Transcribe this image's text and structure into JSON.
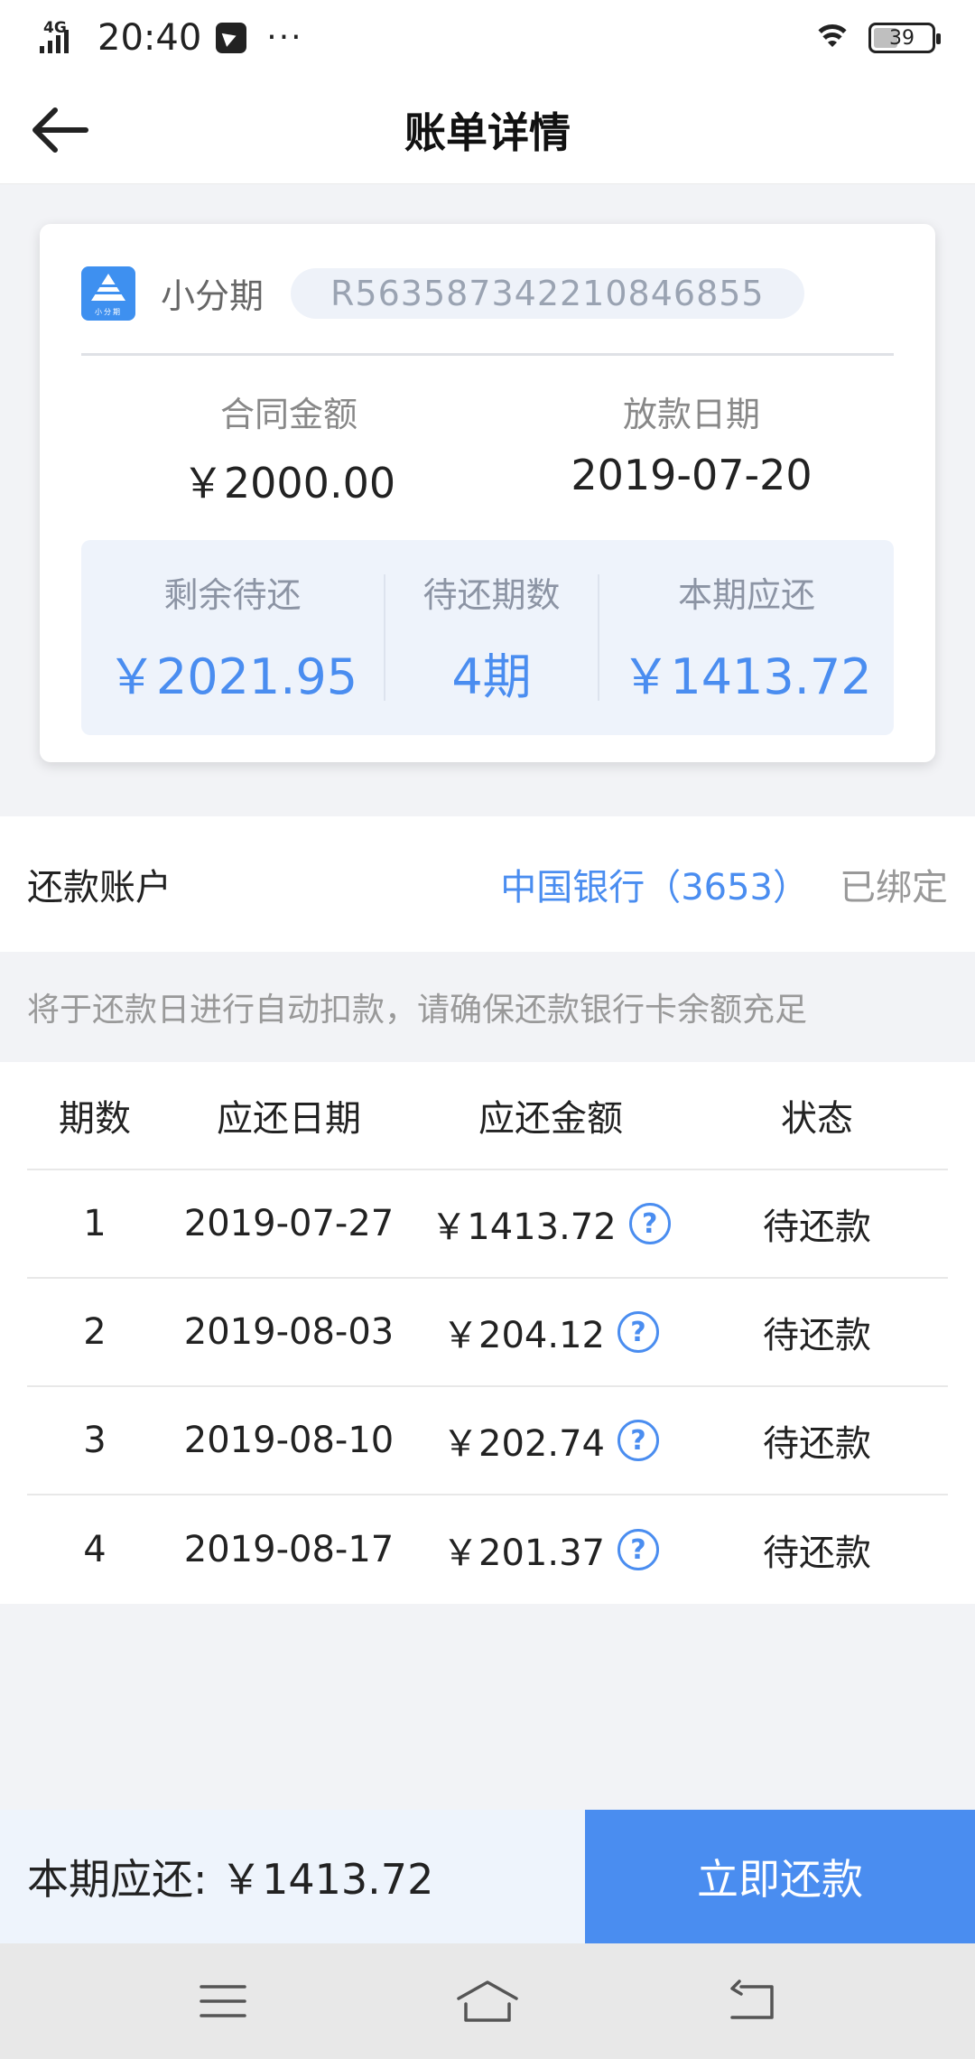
{
  "status_bar": {
    "network": "4G",
    "time": "20:40",
    "more": "···",
    "battery": "39"
  },
  "header": {
    "title": "账单详情"
  },
  "loan": {
    "logo_text": "小分期",
    "product_name": "小分期",
    "contract_no": "R563587342210846855",
    "contract_amount_label": "合同金额",
    "contract_amount": "￥2000.00",
    "loan_date_label": "放款日期",
    "loan_date": "2019-07-20",
    "remaining_label": "剩余待还",
    "remaining": "￥2021.95",
    "periods_left_label": "待还期数",
    "periods_left": "4期",
    "current_due_label": "本期应还",
    "current_due": "￥1413.72"
  },
  "account": {
    "label": "还款账户",
    "bank": "中国银行（3653）",
    "status": "已绑定"
  },
  "notice": "将于还款日进行自动扣款，请确保还款银行卡余额充足",
  "schedule": {
    "headers": [
      "期数",
      "应还日期",
      "应还金额",
      "状态"
    ],
    "rows": [
      {
        "period": "1",
        "date": "2019-07-27",
        "amount": "￥1413.72",
        "status": "待还款"
      },
      {
        "period": "2",
        "date": "2019-08-03",
        "amount": "￥204.12",
        "status": "待还款"
      },
      {
        "period": "3",
        "date": "2019-08-10",
        "amount": "￥202.74",
        "status": "待还款"
      },
      {
        "period": "4",
        "date": "2019-08-17",
        "amount": "￥201.37",
        "status": "待还款"
      }
    ],
    "help_icon_text": "?"
  },
  "bottom": {
    "due_text": "本期应还: ￥1413.72",
    "pay_button": "立即还款"
  },
  "colors": {
    "accent": "#4a8df0",
    "background": "#f2f3f6"
  },
  "icons": {
    "back": "arrow-left-icon",
    "help": "question-circle-icon",
    "nav_menu": "menu-icon",
    "nav_home": "home-icon",
    "nav_back": "return-icon"
  }
}
